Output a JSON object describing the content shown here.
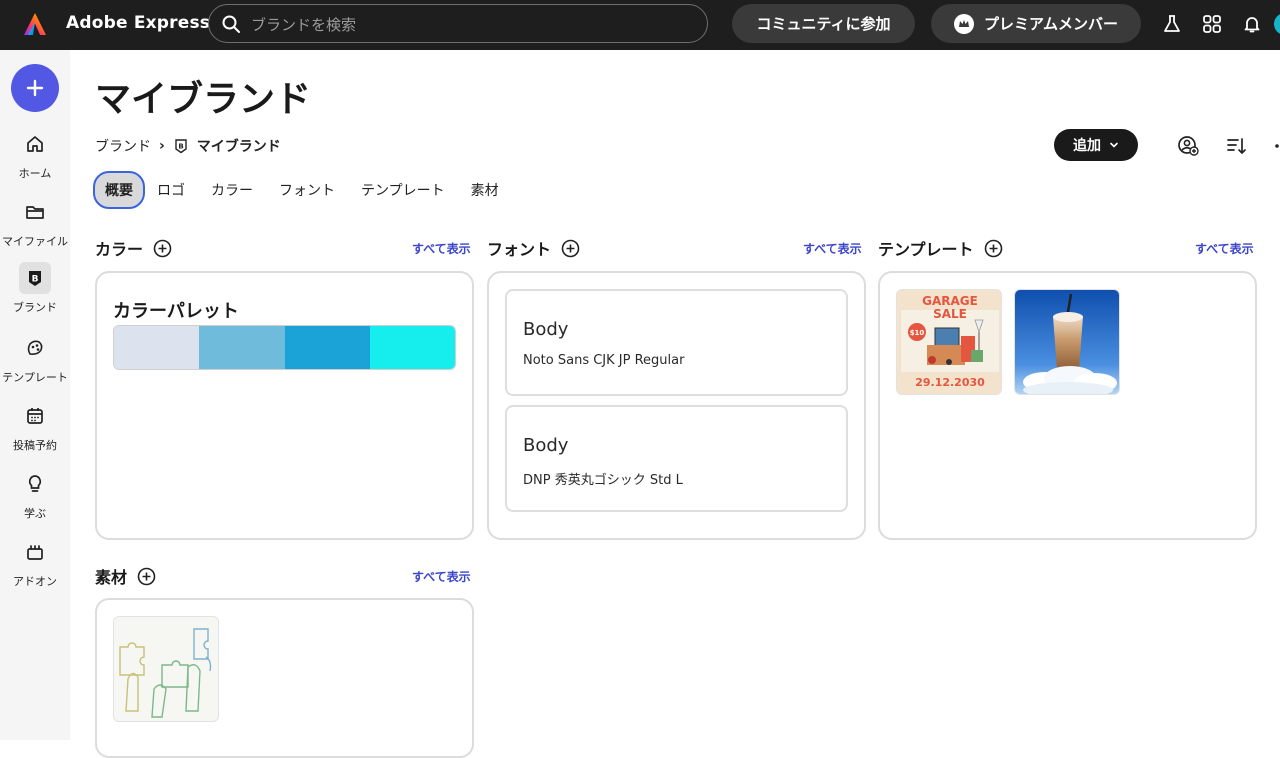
{
  "topbar": {
    "app_name": "Adobe Express",
    "search_placeholder": "ブランドを検索",
    "community_label": "コミュニティに参加",
    "premium_label": "プレミアムメンバー"
  },
  "rail": {
    "items": [
      {
        "label": "ホーム"
      },
      {
        "label": "マイファイル"
      },
      {
        "label": "ブランド"
      },
      {
        "label": "テンプレート"
      },
      {
        "label": "投稿予約"
      },
      {
        "label": "学ぶ"
      },
      {
        "label": "アドオン"
      }
    ]
  },
  "page": {
    "title": "マイブランド",
    "breadcrumb_root": "ブランド",
    "breadcrumb_current": "マイブランド",
    "add_label": "追加"
  },
  "tabs": [
    "概要",
    "ロゴ",
    "カラー",
    "フォント",
    "テンプレート",
    "素材"
  ],
  "sections": {
    "colors": {
      "title": "カラー",
      "see_all": "すべて表示"
    },
    "fonts": {
      "title": "フォント",
      "see_all": "すべて表示"
    },
    "templates": {
      "title": "テンプレート",
      "see_all": "すべて表示"
    },
    "assets": {
      "title": "素材",
      "see_all": "すべて表示"
    }
  },
  "palette": {
    "title": "カラーパレット",
    "colors": [
      "#dce3ee",
      "#6fbbdc",
      "#1ba3d8",
      "#16eeee"
    ]
  },
  "fonts": [
    {
      "role": "Body",
      "name": "Noto Sans CJK JP Regular"
    },
    {
      "role": "Body",
      "name": "DNP 秀英丸ゴシック Std L"
    }
  ],
  "template_thumbs": {
    "garage_sale": {
      "line1": "GARAGE",
      "line2": "SALE",
      "price": "$10",
      "date": "29.12.2030"
    }
  }
}
